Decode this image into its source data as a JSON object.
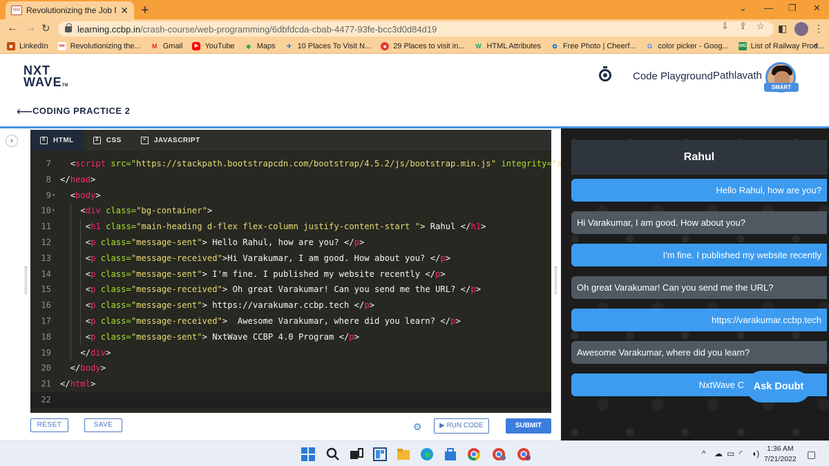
{
  "browser": {
    "tab_title": "Revolutionizing the Job Market |",
    "url_host": "learning.ccbp.in",
    "url_path": "/crash-course/web-programming/6dbfdcda-cbab-4477-93fe-bcc3d0d84d19",
    "bookmarks": [
      {
        "label": "LinkedIn",
        "icon": "briefcase-icon",
        "color": "#c44b00"
      },
      {
        "label": "Revolutionizing the...",
        "icon": "nxtwave-icon",
        "color": "#ffffff"
      },
      {
        "label": "Gmail",
        "icon": "gmail-icon",
        "color": "#d93025"
      },
      {
        "label": "YouTube",
        "icon": "youtube-icon",
        "color": "#ff0000"
      },
      {
        "label": "Maps",
        "icon": "maps-icon",
        "color": "#34a853"
      },
      {
        "label": "10 Places To Visit N...",
        "icon": "plane-icon",
        "color": "#1f6fd8"
      },
      {
        "label": "29 Places to visit in...",
        "icon": "globe-icon",
        "color": "#e53935"
      },
      {
        "label": "HTML Attributes",
        "icon": "w3-icon",
        "color": "#04aa6d"
      },
      {
        "label": "Free Photo | Cheerf...",
        "icon": "freepik-icon",
        "color": "#1273eb"
      },
      {
        "label": "color picker - Goog...",
        "icon": "google-icon",
        "color": "#4285f4"
      },
      {
        "label": "List of Railway Prod...",
        "icon": "gfg-icon",
        "color": "#2f8d46"
      }
    ]
  },
  "header": {
    "logo_line1": "NXT",
    "logo_line2": "WAVE",
    "logo_tm": "TM",
    "code_playground": "Code Playground",
    "user_name": "Pathlavath",
    "badge": "SMART",
    "page_title": "CODING PRACTICE 2"
  },
  "editor": {
    "tabs": [
      {
        "label": "HTML",
        "icon": "html5-icon",
        "active": true
      },
      {
        "label": "CSS",
        "icon": "css3-icon",
        "active": false
      },
      {
        "label": "JAVASCRIPT",
        "icon": "js-file-icon",
        "active": false
      }
    ],
    "line_numbers": [
      "7",
      "8",
      "9",
      "10",
      "11",
      "12",
      "13",
      "14",
      "15",
      "16",
      "17",
      "18",
      "19",
      "20",
      "21",
      "22"
    ],
    "lines": [
      {
        "ind": 2,
        "tokens": [
          [
            "p",
            "<"
          ],
          [
            "t",
            "script"
          ],
          [
            "p",
            " "
          ],
          [
            "a",
            "src="
          ],
          [
            "s",
            "\"https://stackpath.bootstrapcdn.com/bootstrap/4.5.2/js/bootstrap.min.js\""
          ],
          [
            "p",
            " "
          ],
          [
            "a",
            "integrity="
          ],
          [
            "s",
            "\"sh"
          ]
        ]
      },
      {
        "ind": 0,
        "tokens": [
          [
            "p",
            "</"
          ],
          [
            "t",
            "head"
          ],
          [
            "p",
            ">"
          ]
        ]
      },
      {
        "ind": 2,
        "fold": true,
        "tokens": [
          [
            "p",
            "<"
          ],
          [
            "t",
            "body"
          ],
          [
            "p",
            ">"
          ]
        ]
      },
      {
        "ind": 4,
        "fold": true,
        "tokens": [
          [
            "p",
            "<"
          ],
          [
            "t",
            "div"
          ],
          [
            "p",
            " "
          ],
          [
            "a",
            "class="
          ],
          [
            "s",
            "\"bg-container\""
          ],
          [
            "p",
            ">"
          ]
        ]
      },
      {
        "ind": 5,
        "tokens": [
          [
            "p",
            "<"
          ],
          [
            "t",
            "h1"
          ],
          [
            "p",
            " "
          ],
          [
            "a",
            "class="
          ],
          [
            "s",
            "\"main-heading d-flex flex-column justify-content-start \""
          ],
          [
            "p",
            "> Rahul </"
          ],
          [
            "t",
            "h1"
          ],
          [
            "p",
            ">"
          ]
        ]
      },
      {
        "ind": 5,
        "tokens": [
          [
            "p",
            "<"
          ],
          [
            "t",
            "p"
          ],
          [
            "p",
            " "
          ],
          [
            "a",
            "class="
          ],
          [
            "s",
            "\"message-sent\""
          ],
          [
            "p",
            "> Hello Rahul, how are you? </"
          ],
          [
            "t",
            "p"
          ],
          [
            "p",
            ">"
          ]
        ]
      },
      {
        "ind": 5,
        "tokens": [
          [
            "p",
            "<"
          ],
          [
            "t",
            "p"
          ],
          [
            "p",
            " "
          ],
          [
            "a",
            "class="
          ],
          [
            "s",
            "\"message-received\""
          ],
          [
            "p",
            ">Hi Varakumar, I am good. How about you? </"
          ],
          [
            "t",
            "p"
          ],
          [
            "p",
            ">"
          ]
        ]
      },
      {
        "ind": 5,
        "tokens": [
          [
            "p",
            "<"
          ],
          [
            "t",
            "p"
          ],
          [
            "p",
            " "
          ],
          [
            "a",
            "class="
          ],
          [
            "s",
            "\"message-sent\""
          ],
          [
            "p",
            "> I'm fine. I published my website recently </"
          ],
          [
            "t",
            "p"
          ],
          [
            "p",
            ">"
          ]
        ]
      },
      {
        "ind": 5,
        "tokens": [
          [
            "p",
            "<"
          ],
          [
            "t",
            "p"
          ],
          [
            "p",
            " "
          ],
          [
            "a",
            "class="
          ],
          [
            "s",
            "\"message-received\""
          ],
          [
            "p",
            "> Oh great Varakumar! Can you send me the URL? </"
          ],
          [
            "t",
            "p"
          ],
          [
            "p",
            ">"
          ]
        ]
      },
      {
        "ind": 5,
        "tokens": [
          [
            "p",
            "<"
          ],
          [
            "t",
            "p"
          ],
          [
            "p",
            " "
          ],
          [
            "a",
            "class="
          ],
          [
            "s",
            "\"message-sent\""
          ],
          [
            "p",
            "> https://varakumar.ccbp.tech </"
          ],
          [
            "t",
            "p"
          ],
          [
            "p",
            ">"
          ]
        ]
      },
      {
        "ind": 5,
        "tokens": [
          [
            "p",
            "<"
          ],
          [
            "t",
            "p"
          ],
          [
            "p",
            " "
          ],
          [
            "a",
            "class="
          ],
          [
            "s",
            "\"message-received\""
          ],
          [
            "p",
            ">  Awesome Varakumar, where did you learn? </"
          ],
          [
            "t",
            "p"
          ],
          [
            "p",
            ">"
          ]
        ]
      },
      {
        "ind": 5,
        "tokens": [
          [
            "p",
            "<"
          ],
          [
            "t",
            "p"
          ],
          [
            "p",
            " "
          ],
          [
            "a",
            "class="
          ],
          [
            "s",
            "\"message-sent\""
          ],
          [
            "p",
            "> NxtWave CCBP 4.0 Program </"
          ],
          [
            "t",
            "p"
          ],
          [
            "p",
            ">"
          ]
        ]
      },
      {
        "ind": 4,
        "tokens": [
          [
            "p",
            "</"
          ],
          [
            "t",
            "div"
          ],
          [
            "p",
            ">"
          ]
        ]
      },
      {
        "ind": 2,
        "tokens": [
          [
            "p",
            "</"
          ],
          [
            "t",
            "body"
          ],
          [
            "p",
            ">"
          ]
        ]
      },
      {
        "ind": 0,
        "tokens": [
          [
            "p",
            "</"
          ],
          [
            "t",
            "html"
          ],
          [
            "p",
            ">"
          ]
        ]
      },
      {
        "ind": 0,
        "tokens": []
      }
    ],
    "reset_label": "RESET",
    "save_label": "SAVE",
    "run_label": "▶ RUN CODE",
    "submit_label": "SUBMIT"
  },
  "preview": {
    "heading": "Rahul",
    "messages": [
      {
        "type": "sent",
        "text": "Hello Rahul, how are you?"
      },
      {
        "type": "received",
        "text": "Hi Varakumar, I am good. How about you?"
      },
      {
        "type": "sent",
        "text": "I'm fine. I published my website recently"
      },
      {
        "type": "received",
        "text": "Oh great Varakumar! Can you send me the URL?"
      },
      {
        "type": "sent",
        "text": "https://varakumar.ccbp.tech"
      },
      {
        "type": "received",
        "text": "Awesome Varakumar, where did you learn?"
      },
      {
        "type": "sent",
        "text": "NxtWave C"
      }
    ],
    "ask_doubt": "Ask Doubt"
  },
  "taskbar": {
    "time": "1:36 AM",
    "date": "7/21/2022"
  },
  "colors": {
    "accent": "#3b7ddd",
    "sent_bubble": "#3d9cf0",
    "received_bubble": "#505861",
    "tab_strip": "#f7a03a"
  }
}
